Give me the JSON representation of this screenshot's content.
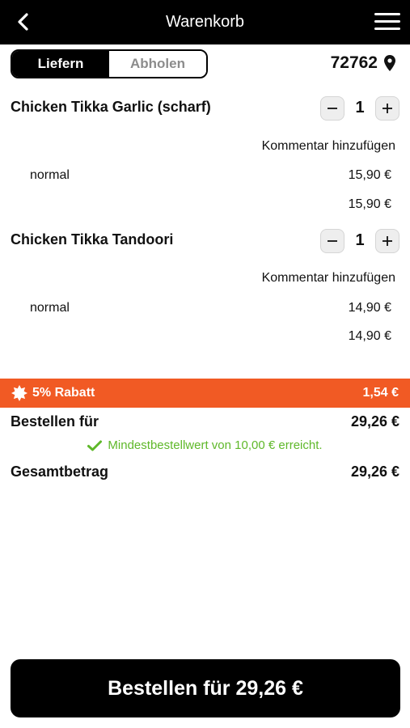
{
  "header": {
    "title": "Warenkorb",
    "back_icon": "chevron-left-icon",
    "menu_icon": "hamburger-menu-icon"
  },
  "delivery_toggle": {
    "options": [
      "Liefern",
      "Abholen"
    ],
    "selected": "Liefern"
  },
  "location": {
    "postcode": "72762",
    "icon": "map-pin-icon"
  },
  "cart_items": [
    {
      "name": "Chicken Tikka Garlic (scharf)",
      "quantity": "1",
      "comment_label": "Kommentar hinzufügen",
      "variant": "normal",
      "variant_price": "15,90 €",
      "item_total": "15,90 €"
    },
    {
      "name": "Chicken Tikka Tandoori",
      "quantity": "1",
      "comment_label": "Kommentar hinzufügen",
      "variant": "normal",
      "variant_price": "14,90 €",
      "item_total": "14,90 €"
    }
  ],
  "discount": {
    "label": "5% Rabatt",
    "amount": "1,54 €",
    "icon": "discount-badge-icon",
    "color": "#f15a24"
  },
  "summary": {
    "order_for_label": "Bestellen für",
    "order_for_value": "29,26 €",
    "min_order_message": "Mindestbestellwert von 10,00 € erreicht.",
    "min_order_icon": "check-icon",
    "min_order_color": "#5fb82a",
    "total_label": "Gesamtbetrag",
    "total_value": "29,26 €"
  },
  "checkout": {
    "button_label": "Bestellen für 29,26 €"
  }
}
